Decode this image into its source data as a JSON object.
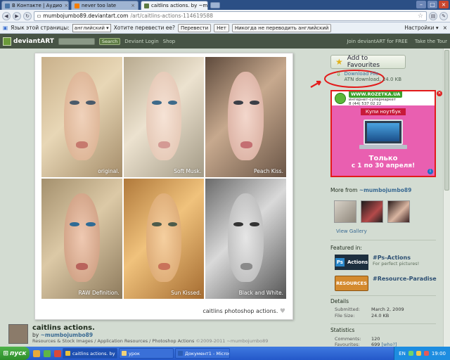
{
  "browser": {
    "tabs": [
      {
        "label": "В Контакте | Аудио",
        "active": false,
        "icon": "vk-icon"
      },
      {
        "label": "never too late",
        "active": false,
        "icon": "blogger-icon"
      },
      {
        "label": "caitlins actions. by ~mumb",
        "active": true,
        "icon": "deviantart-icon"
      }
    ],
    "url_host": "mumbojumbo89.deviantart.com",
    "url_path": "/art/caitlins-actions-114619588"
  },
  "translate_bar": {
    "language_label": "Язык этой страницы:",
    "language_value": "английский",
    "question": "Хотите перевести ее?",
    "translate_button": "Перевести",
    "no_button": "Нет",
    "never_button": "Никогда не переводить английский",
    "settings": "Настройки"
  },
  "site_header": {
    "logo_text": "deviantART",
    "search_button": "Search",
    "login_link": "Deviant Login",
    "shop_link": "Shop",
    "join_link": "Join deviantART for FREE",
    "tour_link": "Take the Tour"
  },
  "artwork": {
    "captions": [
      "original.",
      "Soft Musk.",
      "Peach Kiss.",
      "RAW Definition.",
      "Sun Kissed.",
      "Black and White."
    ],
    "signature": "caitlins photoshop actions.",
    "title": "caitlins actions.",
    "by_prefix": "by",
    "author": "~mumbojumbo89",
    "categories": "Resources & Stock Images / Application Resources / Photoshop Actions",
    "copyright": "©2009-2011 ~mumbojumbo89"
  },
  "sidebar": {
    "add_to_favourites": "Add to Favourites",
    "download_title": "Download File",
    "download_info": "ATN download, 24.0 KB",
    "ad": {
      "site": "WWW.ROZETKA.UA",
      "tagline": "интернет-супермаркет",
      "phone": "8 (44) 537 02 22",
      "promo": "Купи ноутбук",
      "line1": "Только",
      "line2": "с 1 по 30 апреля!"
    },
    "more_from_label": "More from",
    "more_from_user": "~mumbojumbo89",
    "view_gallery": "View Gallery",
    "featured_label": "Featured in:",
    "groups": [
      {
        "name": "#Ps-Actions",
        "desc": "For perfect pictures!",
        "logo_text": "Actions",
        "logo_mark": "Ps"
      },
      {
        "name": "#Resource-Paradise",
        "desc": "",
        "logo_text": "RESOURCES",
        "logo_mark": ""
      }
    ],
    "details_label": "Details",
    "submitted_label": "Submitted:",
    "submitted_value": "March 2, 2009",
    "filesize_label": "File Size:",
    "filesize_value": "24.0 KB",
    "statistics_label": "Statistics",
    "comments_label": "Comments:",
    "comments_value": "120",
    "favourites_label": "Favourites:",
    "favourites_value": "699",
    "favourites_who": "[who?]"
  },
  "taskbar": {
    "start": "пуск",
    "tasks": [
      {
        "label": "caitlins actions. by ~m...",
        "active": true
      },
      {
        "label": "урок",
        "active": false
      },
      {
        "label": "Документ1 - Microsof...",
        "active": false
      }
    ],
    "lang": "EN",
    "clock": "19:00"
  },
  "colors": {
    "page_bg": "#d3dcd2",
    "da_header": "#475445",
    "link": "#3a6a93",
    "ad_border": "#e31a1a",
    "ad_bg": "#e95fb0"
  }
}
